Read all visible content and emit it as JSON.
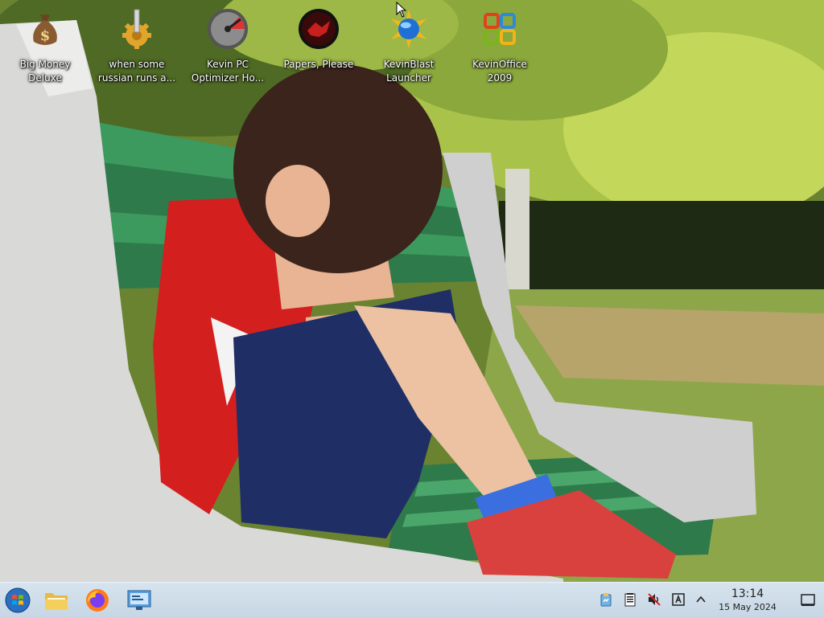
{
  "desktop": {
    "icons": [
      {
        "label": "Big Money Deluxe",
        "icon": "money-bag-icon"
      },
      {
        "label": "when some russian runs a...",
        "icon": "gear-icon"
      },
      {
        "label": "Kevin PC Optimizer Ho...",
        "icon": "speedometer-icon"
      },
      {
        "label": "Papers, Please",
        "icon": "red-emblem-icon"
      },
      {
        "label": "KevinBlast Launcher",
        "icon": "blue-globe-burst-icon"
      },
      {
        "label": "KevinOffice 2009",
        "icon": "office-logo-icon"
      }
    ]
  },
  "taskbar": {
    "pinned": [
      {
        "name": "start-button",
        "icon": "windows-orb-icon"
      },
      {
        "name": "file-explorer",
        "icon": "folder-icon"
      },
      {
        "name": "firefox",
        "icon": "firefox-icon"
      },
      {
        "name": "control-panel",
        "icon": "monitor-settings-icon"
      }
    ],
    "tray": [
      {
        "name": "clipboard",
        "icon": "clipboard-icon"
      },
      {
        "name": "notes",
        "icon": "notes-icon"
      },
      {
        "name": "volume-muted",
        "icon": "speaker-muted-icon"
      },
      {
        "name": "keyboard-layout",
        "icon": "keyboard-layout-icon"
      },
      {
        "name": "show-hidden",
        "icon": "chevron-up-icon"
      }
    ],
    "clock": {
      "time": "13:14",
      "date": "15 May 2024"
    }
  },
  "colors": {
    "taskbar_top": "#d7e4ef",
    "taskbar_bottom": "#c6d6e4",
    "label_text": "#ffffff"
  }
}
